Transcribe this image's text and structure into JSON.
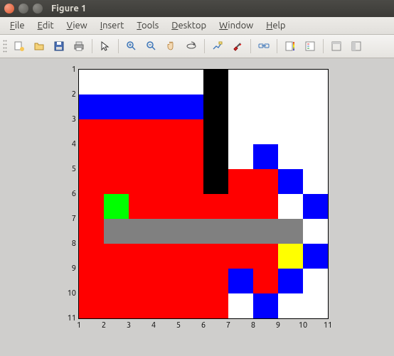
{
  "window": {
    "title": "Figure 1"
  },
  "menu": {
    "file": {
      "label": "File",
      "ul": "F"
    },
    "edit": {
      "label": "Edit",
      "ul": "E"
    },
    "view": {
      "label": "View",
      "ul": "V"
    },
    "insert": {
      "label": "Insert",
      "ul": "I"
    },
    "tools": {
      "label": "Tools",
      "ul": "T"
    },
    "desktop": {
      "label": "Desktop",
      "ul": "D"
    },
    "window": {
      "label": "Window",
      "ul": "W"
    },
    "help": {
      "label": "Help",
      "ul": "H"
    }
  },
  "toolbar": {
    "icons": [
      "new-figure",
      "open-file",
      "save",
      "print",
      "select",
      "zoom-in",
      "zoom-out",
      "pan",
      "rotate",
      "data-cursor",
      "brush",
      "link",
      "colorbar",
      "legend",
      "hide-tools",
      "dock"
    ]
  },
  "chart_data": {
    "type": "heatmap",
    "xlabel": "",
    "ylabel": "",
    "xticks": [
      1,
      2,
      3,
      4,
      5,
      6,
      7,
      8,
      9,
      10,
      11
    ],
    "yticks": [
      1,
      2,
      3,
      4,
      5,
      6,
      7,
      8,
      9,
      10,
      11
    ],
    "xlim": [
      1,
      11
    ],
    "ylim": [
      11,
      1
    ],
    "colors": {
      "W": "#ffffff",
      "K": "#000000",
      "B": "#0000ff",
      "R": "#ff0000",
      "G": "#00ff00",
      "Y": "#ffff00",
      "S": "#808080"
    },
    "grid": [
      [
        "W",
        "W",
        "W",
        "W",
        "W",
        "K",
        "W",
        "W",
        "W",
        "W"
      ],
      [
        "B",
        "B",
        "B",
        "B",
        "B",
        "K",
        "W",
        "W",
        "W",
        "W"
      ],
      [
        "R",
        "R",
        "R",
        "R",
        "R",
        "K",
        "W",
        "W",
        "W",
        "W"
      ],
      [
        "R",
        "R",
        "R",
        "R",
        "R",
        "K",
        "W",
        "B",
        "W",
        "W"
      ],
      [
        "R",
        "R",
        "R",
        "R",
        "R",
        "K",
        "R",
        "R",
        "B",
        "W"
      ],
      [
        "R",
        "G",
        "R",
        "R",
        "R",
        "R",
        "R",
        "R",
        "W",
        "B"
      ],
      [
        "R",
        "S",
        "S",
        "S",
        "S",
        "S",
        "S",
        "S",
        "S",
        "W"
      ],
      [
        "R",
        "R",
        "R",
        "R",
        "R",
        "R",
        "R",
        "R",
        "Y",
        "B"
      ],
      [
        "R",
        "R",
        "R",
        "R",
        "R",
        "R",
        "B",
        "R",
        "B",
        "W"
      ],
      [
        "R",
        "R",
        "R",
        "R",
        "R",
        "R",
        "W",
        "B",
        "W",
        "W"
      ]
    ]
  }
}
